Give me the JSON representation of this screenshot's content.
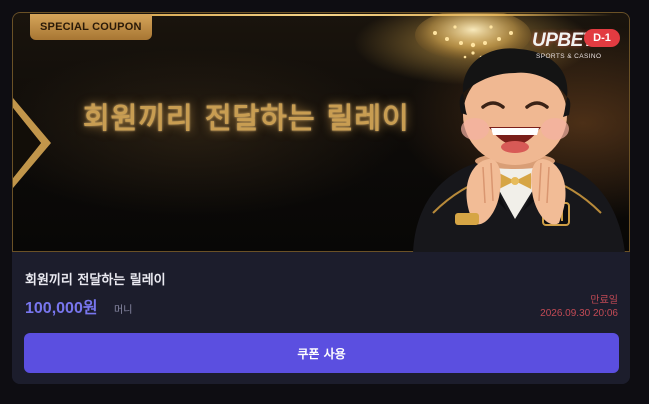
{
  "banner": {
    "badge": "SPECIAL COUPON",
    "title": "회원끼리 전달하는 릴레이",
    "brand": "UPBET",
    "brand_sub": "SPORTS & CASINO",
    "d_day": "D-1"
  },
  "coupon": {
    "title": "회원끼리 전달하는 릴레이",
    "amount": "100,000원",
    "amount_unit": "머니",
    "expiry_label": "만료일",
    "expiry_date": "2026.09.30 20:06",
    "button_label": "쿠폰 사용"
  },
  "colors": {
    "accent": "#5b4fe0",
    "amount": "#7876ee",
    "expiry": "#c24a55",
    "gold": "#c89d52",
    "badge": "#e23b41"
  },
  "icons": [
    "chandelier-icon",
    "chevron-left-icon",
    "mascot-illustration"
  ]
}
